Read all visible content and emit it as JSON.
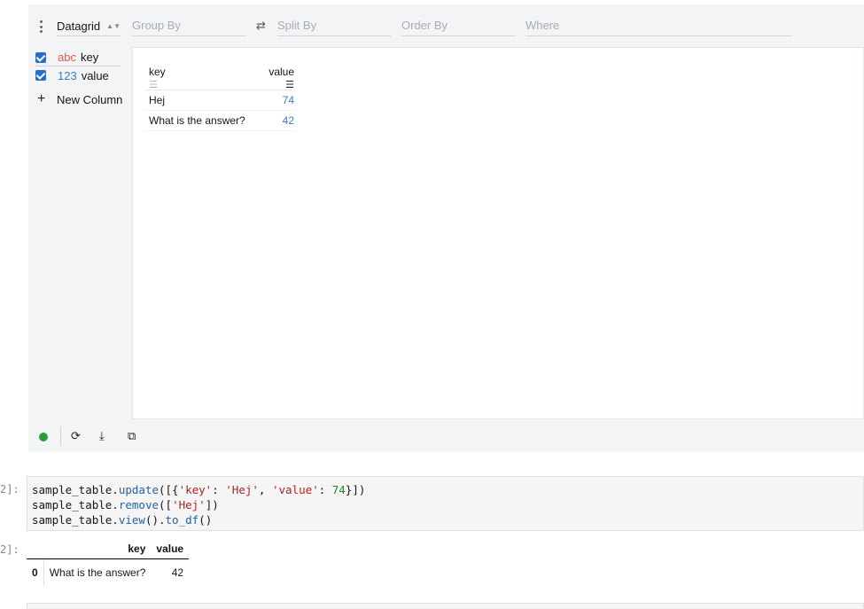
{
  "viewer": {
    "plugin": "Datagrid",
    "group_by": "Group By",
    "split_by": "Split By",
    "order_by": "Order By",
    "where": "Where",
    "swap_glyph": "⇄",
    "columns": [
      {
        "type": "abc",
        "name": "key",
        "checked": true
      },
      {
        "type": "123",
        "name": "value",
        "checked": true
      }
    ],
    "new_column": "New Column",
    "grid": {
      "headers": [
        "key",
        "value"
      ],
      "rows": [
        {
          "key": "Hej",
          "value": "74"
        },
        {
          "key": "What is the answer?",
          "value": "42"
        }
      ]
    },
    "status_color": "#2a9d3a"
  },
  "cell": {
    "prompt_in": "2]:",
    "prompt_out": "2]:",
    "code_lines": [
      "sample_table.update([{'key': 'Hej', 'value': 74}])",
      "sample_table.remove(['Hej'])",
      "sample_table.view().to_df()"
    ]
  },
  "output": {
    "headers": [
      "",
      "key",
      "value"
    ],
    "rows": [
      {
        "index": "0",
        "key": "What is the answer?",
        "value": "42"
      }
    ]
  }
}
